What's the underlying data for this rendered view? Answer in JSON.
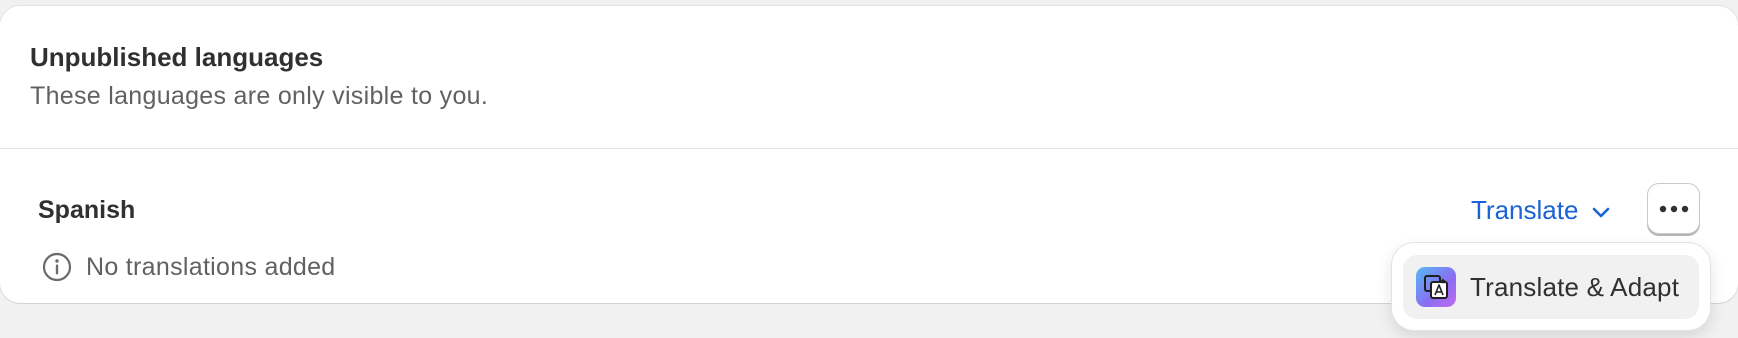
{
  "section": {
    "title": "Unpublished languages",
    "subtitle": "These languages are only visible to you."
  },
  "language_row": {
    "name": "Spanish",
    "status_icon": "info-icon",
    "status_text": "No translations added",
    "translate_label": "Translate",
    "translate_icon": "chevron-down-icon",
    "more_icon": "more-horizontal-icon"
  },
  "popover_menu": {
    "items": [
      {
        "label": "Translate & Adapt",
        "icon": "translate-adapt-app-icon"
      }
    ]
  },
  "colors": {
    "background": "#f1f1f1",
    "card": "#ffffff",
    "link_blue": "#1a63d6",
    "text_primary": "#303030",
    "text_secondary": "#616161"
  }
}
